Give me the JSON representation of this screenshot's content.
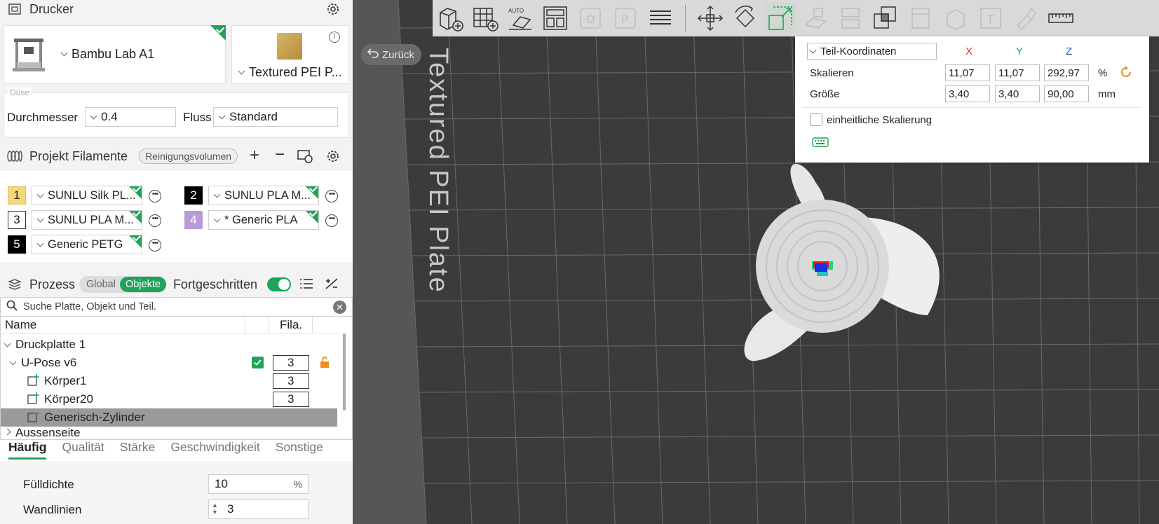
{
  "printer": {
    "section_title": "Drucker",
    "model": "Bambu Lab A1",
    "plate": "Textured PEI P..."
  },
  "nozzle": {
    "group_label": "Düse",
    "diameter_label": "Durchmesser",
    "diameter_value": "0.4",
    "flow_label": "Fluss",
    "flow_value": "Standard"
  },
  "filaments": {
    "section_title": "Projekt Filamente",
    "purge_button": "Reinigungsvolumen",
    "items": [
      {
        "num": "1",
        "name": "SUNLU Silk PL...",
        "color": "#f5d77a",
        "text_color": "#222"
      },
      {
        "num": "2",
        "name": "SUNLU PLA M...",
        "color": "#000000",
        "text_color": "#fff"
      },
      {
        "num": "3",
        "name": "SUNLU PLA M...",
        "color": "#ffffff",
        "text_color": "#222"
      },
      {
        "num": "4",
        "name": "* Generic PLA",
        "color": "#b79ad6",
        "text_color": "#fff"
      },
      {
        "num": "5",
        "name": "Generic PETG",
        "color": "#000000",
        "text_color": "#fff"
      }
    ]
  },
  "process": {
    "section_title": "Prozess",
    "global_label": "Global",
    "objects_label": "Objekte",
    "advanced_label": "Fortgeschritten",
    "advanced_on": true
  },
  "search": {
    "placeholder": "Suche Platte, Objekt und Teil."
  },
  "tree": {
    "col_name": "Name",
    "col_fila": "Fila.",
    "rows": [
      {
        "label": "Druckplatte 1"
      },
      {
        "label": "U-Pose v6",
        "fila": "3"
      },
      {
        "label": "Körper1",
        "fila": "3"
      },
      {
        "label": "Körper20",
        "fila": "3"
      },
      {
        "label": "Generisch-Zylinder"
      },
      {
        "label": "Aussenseite"
      }
    ]
  },
  "settings_tabs": [
    "Häufig",
    "Qualität",
    "Stärke",
    "Geschwindigkeit",
    "Sonstige"
  ],
  "settings": {
    "infill_label": "Fülldichte",
    "infill_value": "10",
    "infill_unit": "%",
    "walls_label": "Wandlinien",
    "walls_value": "3"
  },
  "viewport": {
    "back_label": "Zurück",
    "plate_text": "Textured PEI Plate"
  },
  "scale_panel": {
    "coord_mode": "Teil-Koordinaten",
    "x_label": "X",
    "y_label": "Y",
    "z_label": "Z",
    "scale_label": "Skalieren",
    "scale_x": "11,07",
    "scale_y": "11,07",
    "scale_z": "292,97",
    "scale_unit": "%",
    "size_label": "Größe",
    "size_x": "3,40",
    "size_y": "3,40",
    "size_z": "90,00",
    "size_unit": "mm",
    "uniform_label": "einheitliche Skalierung",
    "x_color": "#e03030",
    "y_color": "#1fa35a",
    "z_color": "#2050c0"
  },
  "colors": {
    "accent": "#1fa35a"
  }
}
